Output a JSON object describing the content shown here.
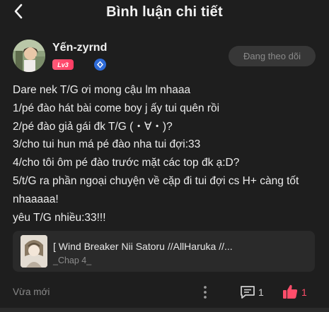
{
  "header": {
    "title": "Bình luận chi tiết",
    "back_icon": "chevron-left-icon"
  },
  "author": {
    "name": "Yến-zyrnd",
    "level": "Lv3",
    "verified_icon": "diamond-verified-icon",
    "follow_label": "Đang theo dõi"
  },
  "comment": {
    "lines": [
      "Dare nek T/G ơi mong cậu lm nhaaa",
      "1/pé đào hát bài come boy j ấy tui quên rồi",
      "2/pé đào giả gái đk T/G (・∀・)?",
      "3/cho tui hun má pé đào nha tui đợi:33",
      "4/cho tôi ôm pé đào trước mặt các top đk ạ:D?",
      "5/t/G ra phần ngoại chuyện về cặp đi tui đợi cs H+ càng tốt nhaaaaa!",
      "yêu T/G nhiều:33!!!"
    ]
  },
  "story": {
    "title": "[ Wind Breaker Nii Satoru //AllHaruka //...",
    "chapter": "_Chap 4_"
  },
  "footer": {
    "time": "Vừa mới",
    "more_icon": "more-vertical-icon",
    "comment_icon": "comment-icon",
    "comment_count": "1",
    "like_icon": "thumbs-up-icon",
    "like_count": "1"
  },
  "colors": {
    "background": "#1e1e1e",
    "accent": "#ff4d6a",
    "level_badge": "#ff3d64",
    "verify_badge": "#2e6bd8"
  }
}
